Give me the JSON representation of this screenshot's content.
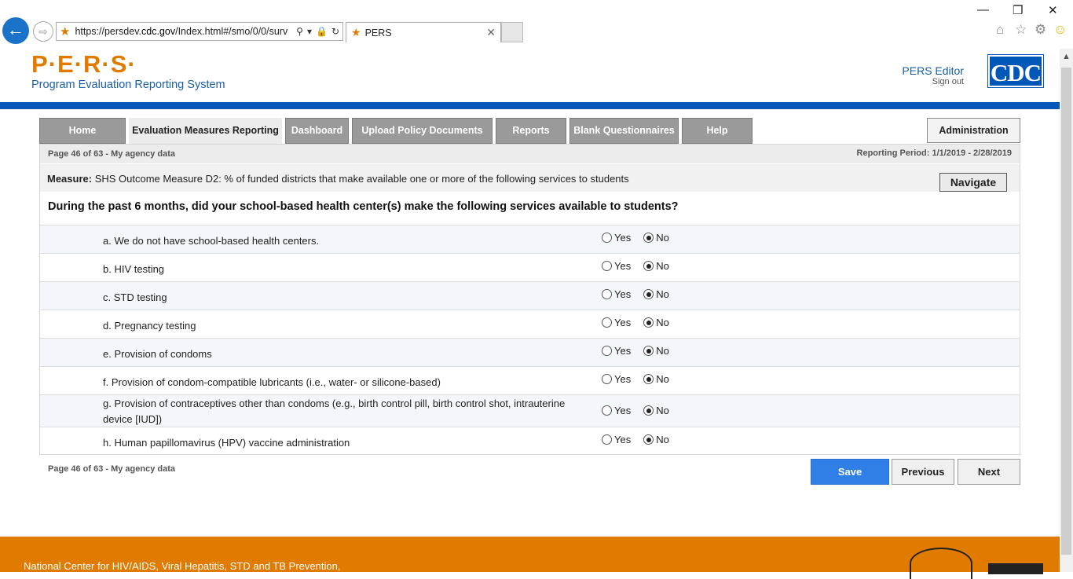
{
  "browser": {
    "url_prefix": "https://persdev.",
    "url_domain": "cdc.gov",
    "url_suffix": "/Index.html#/smo/0/0/surv",
    "tab_title": "PERS"
  },
  "header": {
    "logo": "P·E·R·S·",
    "subtitle": "Program Evaluation Reporting System",
    "user": "PERS Editor",
    "sign_out": "Sign out",
    "cdc_logo": "CDC"
  },
  "nav": {
    "tabs": [
      "Home",
      "Evaluation Measures Reporting",
      "Dashboard",
      "Upload Policy Documents",
      "Reports",
      "Blank Questionnaires",
      "Help"
    ],
    "admin": "Administration"
  },
  "page": {
    "page_info": "Page 46 of 63 - My agency data",
    "reporting_period": "Reporting Period: 1/1/2019 - 2/28/2019",
    "measure_label": "Measure:",
    "measure_text": "SHS Outcome Measure D2: % of funded districts that make available one or more of the following services to students",
    "navigate": "Navigate",
    "question": "During the past 6 months, did your school-based health center(s) make the following services available to students?",
    "yes": "Yes",
    "no": "No",
    "items": [
      {
        "label": "a. We do not have school-based health centers.",
        "answer": "No"
      },
      {
        "label": "b. HIV testing",
        "answer": "No"
      },
      {
        "label": "c. STD testing",
        "answer": "No"
      },
      {
        "label": "d. Pregnancy testing",
        "answer": "No"
      },
      {
        "label": "e. Provision of condoms",
        "answer": "No"
      },
      {
        "label": "f. Provision of condom-compatible lubricants (i.e., water- or silicone-based)",
        "answer": "No"
      },
      {
        "label": "g. Provision of contraceptives other than condoms (e.g., birth control pill, birth control shot, intrauterine device [IUD])",
        "answer": "No"
      },
      {
        "label": "h. Human papillomavirus (HPV) vaccine administration",
        "answer": "No"
      }
    ],
    "footer_page_info": "Page 46 of 63 - My agency data",
    "save": "Save",
    "previous": "Previous",
    "next": "Next"
  },
  "footer": {
    "text": "National Center for HIV/AIDS, Viral Hepatitis, STD and TB Prevention,"
  },
  "colors": {
    "brand_orange": "#e07b00",
    "brand_blue": "#0057b7",
    "save_blue": "#2f7fe6"
  }
}
